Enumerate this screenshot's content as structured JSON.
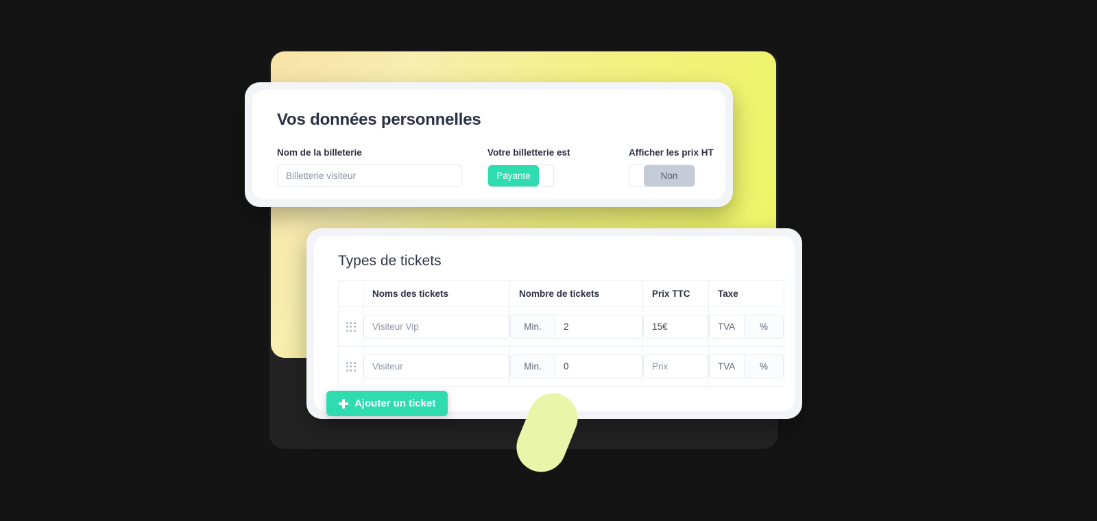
{
  "theme": {
    "canvas_bg": "#141414",
    "dark_panel_bg": "#232323",
    "accent_teal": "#2edcb0",
    "yellow_start": "#f8e2a8",
    "yellow_end": "#edf566",
    "pill_color": "#e9f5a8",
    "heading_color": "#2b3044",
    "placeholder_color": "#8b93a4"
  },
  "personal_card": {
    "title": "Vos données personnelles",
    "name_field": {
      "label": "Nom de la billeterie",
      "value": "",
      "placeholder": "Billetterie visiteur"
    },
    "type_toggle": {
      "label": "Votre billetterie est",
      "value": "Payante",
      "state": "on"
    },
    "ht_toggle": {
      "label": "Afficher les prix HT",
      "value": "Non",
      "state": "off"
    }
  },
  "tickets_card": {
    "title": "Types de tickets",
    "columns": [
      {
        "key": "handle",
        "label": ""
      },
      {
        "key": "name",
        "label": "Noms des tickets"
      },
      {
        "key": "count",
        "label": "Nombre de tickets"
      },
      {
        "key": "price",
        "label": "Prix TTC"
      },
      {
        "key": "tax",
        "label": "Taxe"
      }
    ],
    "rows": [
      {
        "handle_icon": "drag-handle-icon",
        "name": {
          "value": "",
          "placeholder": "Visiteur Vip"
        },
        "count": {
          "addon": "Min.",
          "value": "2",
          "placeholder": ""
        },
        "price": {
          "value": "15€",
          "placeholder": ""
        },
        "tax": {
          "label": "TVA",
          "suffix": "%"
        }
      },
      {
        "handle_icon": "drag-handle-icon",
        "name": {
          "value": "",
          "placeholder": "Visiteur"
        },
        "count": {
          "addon": "Min.",
          "value": "0",
          "placeholder": ""
        },
        "price": {
          "value": "",
          "placeholder": "Prix"
        },
        "tax": {
          "label": "TVA",
          "suffix": "%"
        }
      }
    ],
    "add_button": {
      "icon": "plus-icon",
      "label": "Ajouter un ticket"
    }
  }
}
